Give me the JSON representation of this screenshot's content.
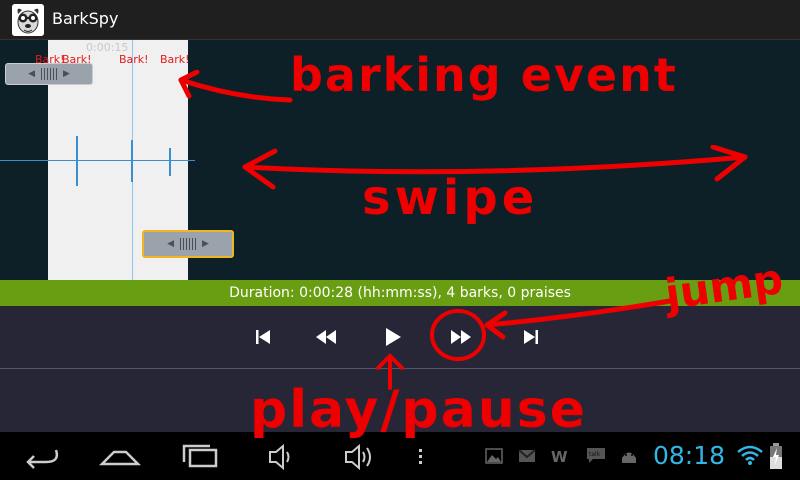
{
  "app": {
    "title": "BarkSpy"
  },
  "waveform": {
    "time_label": "0:00:15",
    "bark_labels": [
      "Bark!",
      "Bark!",
      "Bark!",
      "Bark!"
    ]
  },
  "status": {
    "text": "Duration: 0:00:28 (hh:mm:ss), 4 barks,  0 praises"
  },
  "player": {
    "controls": [
      "skip-previous",
      "rewind",
      "play",
      "fast-forward",
      "skip-next"
    ]
  },
  "annotations": {
    "barking_event": "barking event",
    "swipe": "swipe",
    "jump": "jump",
    "play_pause": "play/pause"
  },
  "system_bar": {
    "clock": "08:18",
    "notification_icons": [
      "gallery-icon",
      "gmail-icon",
      "wordpress-icon",
      "talk-icon",
      "android-icon"
    ],
    "nav_buttons": [
      "back",
      "home",
      "recent-apps",
      "volume-down",
      "volume-up",
      "menu"
    ]
  },
  "colors": {
    "action_bar": "#1f1f1f",
    "wave_background": "#0d2027",
    "selection": "#f0f0f0",
    "waveform": "#3a8fd0",
    "bark_label": "#e31b1b",
    "status_bar": "#6a9e12",
    "controls_background": "#262636",
    "clock": "#33b5e5",
    "annotation": "#ee0000",
    "active_handle": "#f2b423"
  }
}
